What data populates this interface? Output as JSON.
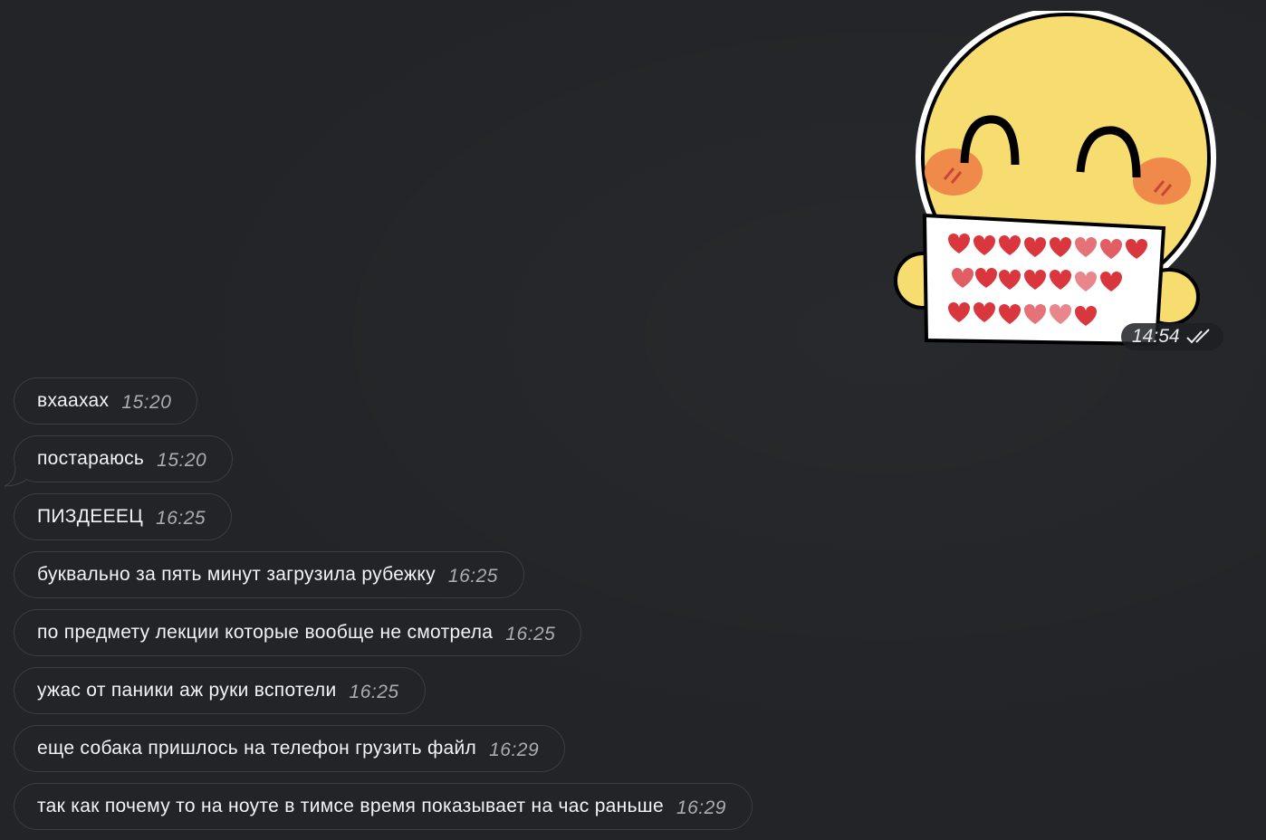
{
  "sticker": {
    "time": "14:54",
    "status_icon": "double-check-icon",
    "colors": {
      "face": "#f7dc6f",
      "outline": "#000000",
      "blush": "#f08a4b",
      "heart": "#d9363e"
    }
  },
  "messages": [
    {
      "text": "вхаахах",
      "time": "15:20"
    },
    {
      "text": "постараюсь",
      "time": "15:20"
    },
    {
      "text": "ПИЗДЕЕЕЦ",
      "time": "16:25"
    },
    {
      "text": "буквально за пять минут загрузила рубежку",
      "time": "16:25"
    },
    {
      "text": "по предмету лекции которые вообще не смотрела",
      "time": "16:25"
    },
    {
      "text": "ужас от паники аж руки вспотели",
      "time": "16:25"
    },
    {
      "text": "еще собака пришлось на телефон грузить файл",
      "time": "16:29"
    },
    {
      "text": "так как почему то на ноуте в тимсе время показывает на час раньше",
      "time": "16:29"
    }
  ],
  "theme": {
    "background": "#222427",
    "bubble_border": "#3a3d41",
    "text": "#f2f3f4",
    "time_text": "#a9adb3"
  }
}
